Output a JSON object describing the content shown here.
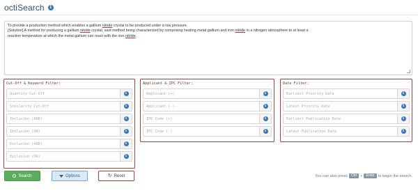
{
  "header": {
    "title": "octiSearch",
    "info_icon": "info-icon"
  },
  "query": {
    "line1_a": "To provide a production method which enables a gallium ",
    "line1_u": "nitride",
    "line1_b": " crystal to be produced under a low pressure.",
    "line2_a": "[Solution] A method for producing a gallium ",
    "line2_u": "nitride",
    "line2_b": " crystal, said method being characterized by comprising heating metal gallium and iron ",
    "line2_u2": "nitride",
    "line2_c": " in a nitrogen atmosphere to at least a",
    "line3_a": "reaction temperature at which the metal gallium can react with the iron ",
    "line3_u": "nitride",
    "line3_b": "."
  },
  "panels": {
    "cutoff": {
      "title": "Cut-Off & Keyword Filter:",
      "fields": [
        {
          "placeholder": "Quantity Cut-Off"
        },
        {
          "placeholder": "Similarity Cut-Off"
        },
        {
          "placeholder": "Inclusion (AND)"
        },
        {
          "placeholder": "Inclusion (OR)"
        },
        {
          "placeholder": "Exclusion (AND)"
        },
        {
          "placeholder": "Exclusion (OR)"
        }
      ]
    },
    "applicant": {
      "title": "Applicant & IPC Filter:",
      "fields": [
        {
          "placeholder": "Applicant (+)"
        },
        {
          "placeholder": "Applicant (-)"
        },
        {
          "placeholder": "IPC Code (+)"
        },
        {
          "placeholder": "IPC Code (-)"
        }
      ]
    },
    "date": {
      "title": "Date Filter:",
      "fields": [
        {
          "placeholder": "Earliest Priority Date"
        },
        {
          "placeholder": "Latest Priority Date"
        },
        {
          "placeholder": "Earliest Publication Date"
        },
        {
          "placeholder": "Latest Publication Date"
        }
      ]
    }
  },
  "buttons": {
    "search": "Search",
    "options": "Options",
    "reset": "Reset"
  },
  "hint": {
    "prefix": "You can also press",
    "key1": "Ctrl",
    "plus": "+",
    "key2": "Enter",
    "suffix": "to begin the search."
  },
  "colors": {
    "accent": "#3b78b8",
    "panel_border": "#b83a3a",
    "search_green": "#5cad5c"
  }
}
